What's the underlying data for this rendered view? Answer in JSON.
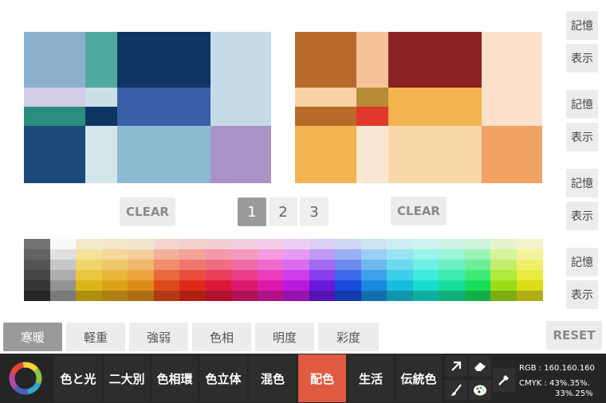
{
  "side_buttons": [
    {
      "label": "記憶"
    },
    {
      "label": "表示"
    },
    {
      "label": "記憶"
    },
    {
      "label": "表示"
    },
    {
      "label": "記憶"
    },
    {
      "label": "表示"
    },
    {
      "label": "記憶"
    },
    {
      "label": "表示"
    }
  ],
  "clear_label": "CLEAR",
  "pages": [
    "1",
    "2",
    "3"
  ],
  "active_page": "1",
  "reset_label": "RESET",
  "tabs": [
    "寒暖",
    "軽重",
    "強弱",
    "色相",
    "明度",
    "彩度"
  ],
  "active_tab": "寒暖",
  "modes": [
    "色と光",
    "二大別",
    "色相環",
    "色立体",
    "混色",
    "配色",
    "生活",
    "伝統色"
  ],
  "active_mode": "配色",
  "readout": {
    "rgb": "RGB : 160.160.160",
    "cmyk": "CMYK : 43%.35%.",
    "cmyk2": "33%.25%"
  },
  "tools": [
    "arrow-icon",
    "eraser-icon",
    "brush-icon",
    "palette-icon",
    "eyedropper-icon"
  ],
  "colors": {
    "accent": "#e05a41",
    "bar": "#252525"
  }
}
